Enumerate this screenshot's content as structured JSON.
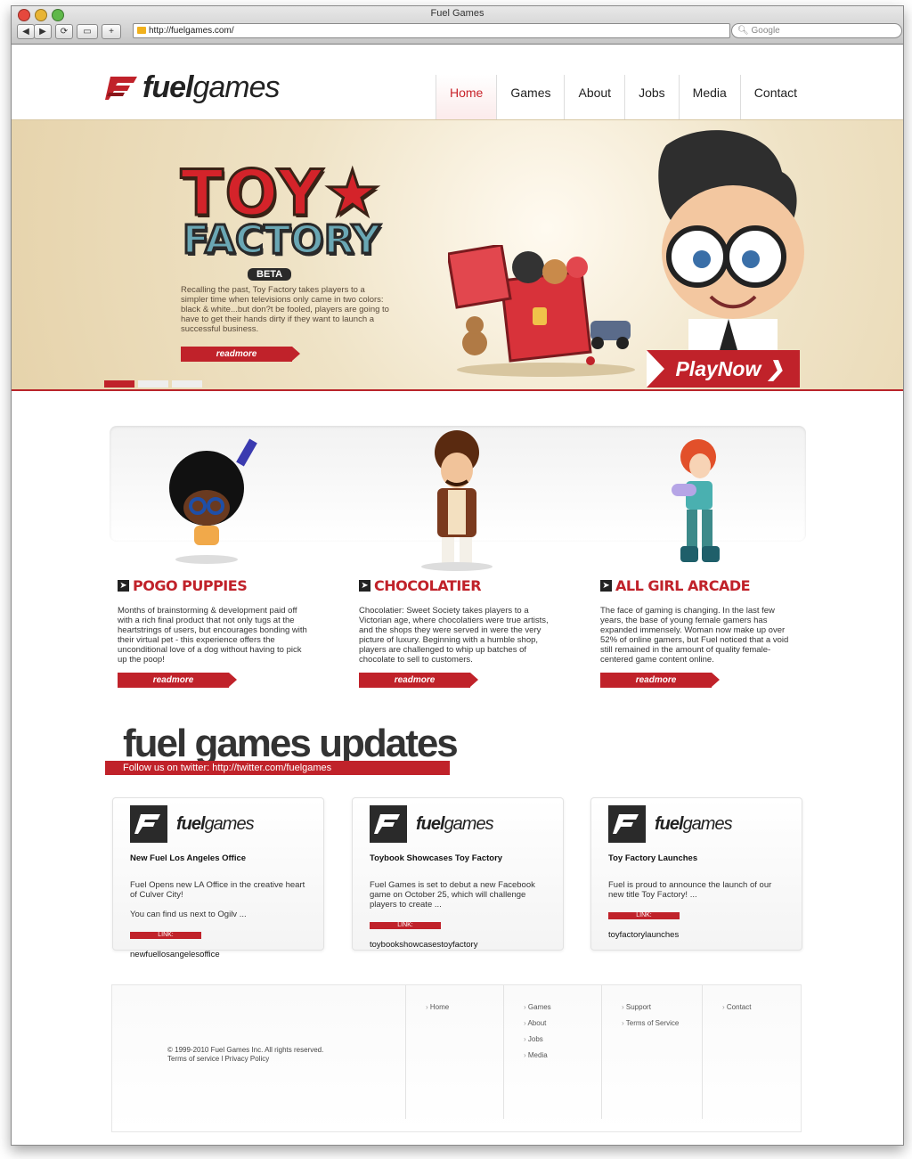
{
  "browser": {
    "title": "Fuel Games",
    "url": "http://fuelgames.com/",
    "search_placeholder": "Google",
    "buttons": {
      "back": "◀",
      "forward": "▶",
      "reload": "⟳",
      "rss": "▭",
      "add": "+"
    }
  },
  "header": {
    "logo_bold": "fuel",
    "logo_light": "games",
    "nav": [
      {
        "label": "Home",
        "active": true
      },
      {
        "label": "Games"
      },
      {
        "label": "About"
      },
      {
        "label": "Jobs"
      },
      {
        "label": "Media"
      },
      {
        "label": "Contact"
      }
    ]
  },
  "hero": {
    "title_line1": "TOY★",
    "title_line2": "FACTORY",
    "badge": "BETA",
    "description": "Recalling the past, Toy Factory takes players to a simpler time when televisions only came in two colors: black & white...but don?t be fooled, players are going to have to get their hands dirty if they want to launch a successful business.",
    "read_more": "readmore",
    "play_now": "PlayNow ❯"
  },
  "games": [
    {
      "title": "POGO PUPPIES",
      "description": "Months of brainstorming & development paid off with a rich final product that not only tugs at the heartstrings of users, but encourages bonding with their virtual pet - this experience offers the unconditional love of a dog without having to pick up the poop!",
      "read_more": "readmore"
    },
    {
      "title": "CHOCOLATIER",
      "description": "Chocolatier: Sweet Society takes players to a Victorian age, where chocolatiers were true artists, and the shops they were served in were the very picture of luxury. Beginning with a humble shop, players are challenged to whip up batches of chocolate to sell to customers.",
      "read_more": "readmore"
    },
    {
      "title": "ALL GIRL ARCADE",
      "description": "The face of gaming is changing. In the last few years, the base of young female gamers has expanded immensely. Woman now make up over 52% of online gamers, but Fuel noticed that a void still remained in the amount of quality female-centered game content online.",
      "read_more": "readmore"
    }
  ],
  "updates": {
    "title": "fuel games updates",
    "follow": "Follow us on twitter: http://twitter.com/fuelgames",
    "cards": [
      {
        "logo_bold": "fuel",
        "logo_light": "games",
        "heading": "New Fuel Los Angeles Office",
        "body": "Fuel Opens new LA Office in the creative heart of Culver City!\n\nYou can find us next to Ogilv ...",
        "link_label": "LINK:",
        "link": "newfuellosangelesoffice"
      },
      {
        "logo_bold": "fuel",
        "logo_light": "games",
        "heading": "Toybook Showcases Toy Factory",
        "body": "Fuel Games is set to debut a new Facebook game on October 25, which will challenge players to create ...",
        "link_label": "LINK:",
        "link": "toybookshowcasestoyfactory"
      },
      {
        "logo_bold": "fuel",
        "logo_light": "games",
        "heading": "Toy Factory Launches",
        "body": "Fuel is proud to announce the launch of our new title Toy Factory! ...",
        "link_label": "LINK:",
        "link": "toyfactorylaunches"
      }
    ]
  },
  "footer": {
    "copyright": "© 1999-2010 Fuel Games Inc. All rights reserved.",
    "legal": "Terms of service l Privacy Policy",
    "col1": [
      "Home"
    ],
    "col2": [
      "Games",
      "About",
      "Jobs",
      "Media"
    ],
    "col3": [
      "Support",
      "Terms of Service"
    ],
    "col4": [
      "Contact"
    ]
  },
  "colors": {
    "accent": "#c0222a",
    "text": "#222222"
  }
}
